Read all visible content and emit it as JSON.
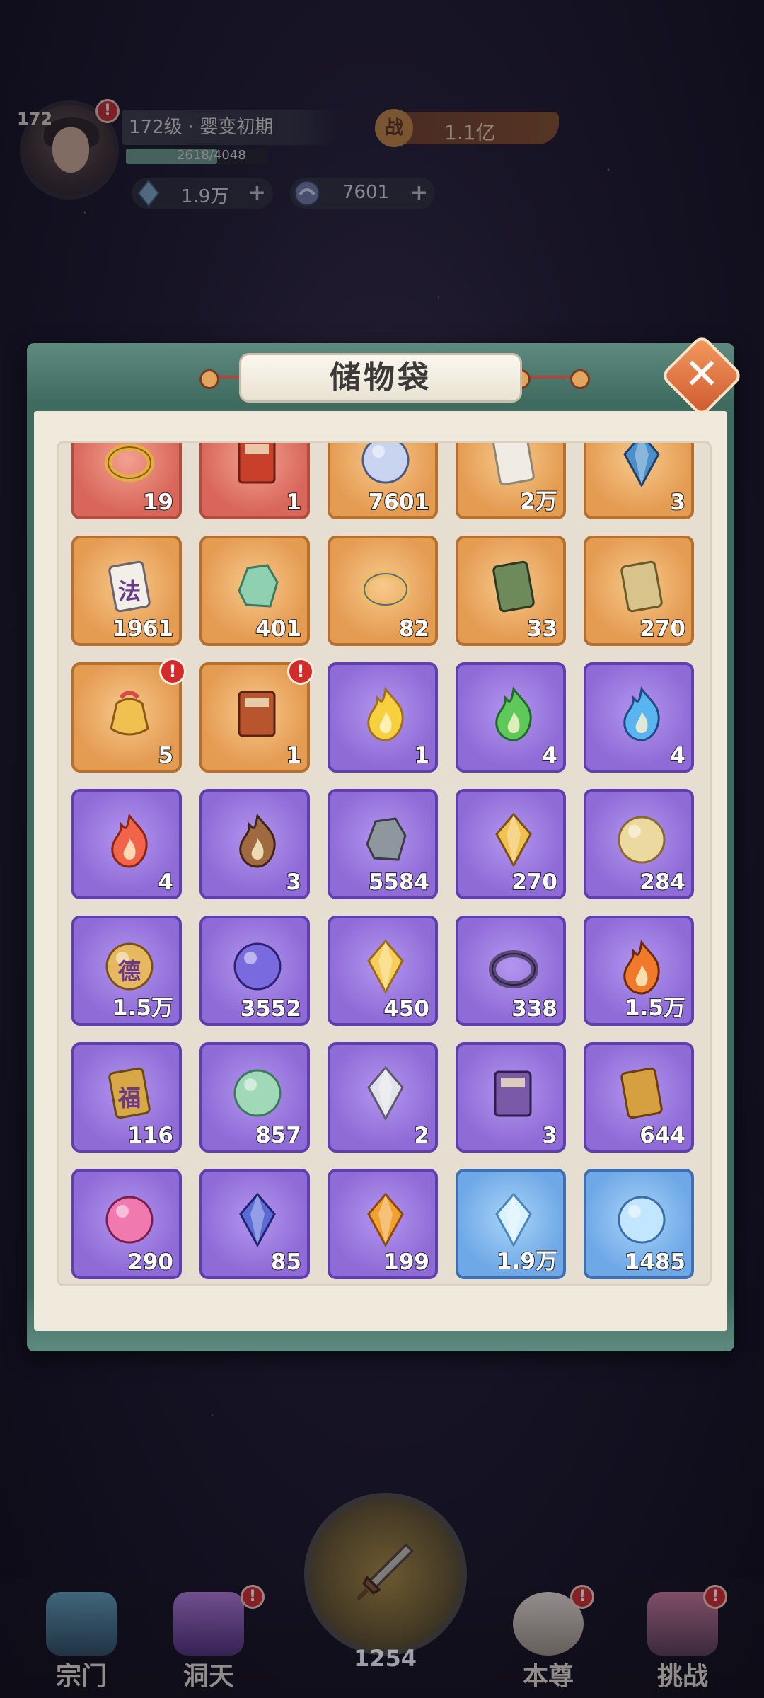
{
  "hud": {
    "level_badge": "172",
    "realm_label": "172级 · 婴变初期",
    "exp_text": "2618/4048",
    "exp_progress": 0.647,
    "power_glyph": "战",
    "power_value": "1.1亿",
    "gem_value": "1.9万",
    "coin_value": "7601",
    "plus_glyph": "+",
    "alert_glyph": "!"
  },
  "modal": {
    "title": "储物袋",
    "close_glyph": "✕"
  },
  "inventory": [
    [
      {
        "qty": "19",
        "rarity": "red",
        "icon": "golden-ring-icon"
      },
      {
        "qty": "1",
        "rarity": "red",
        "icon": "red-book-icon"
      },
      {
        "qty": "7601",
        "rarity": "orange",
        "icon": "spirit-coin-icon"
      },
      {
        "qty": "2万",
        "rarity": "orange",
        "icon": "white-cloth-icon"
      },
      {
        "qty": "3",
        "rarity": "orange",
        "icon": "blue-crystal-shard-icon"
      }
    ],
    [
      {
        "qty": "1961",
        "rarity": "orange",
        "icon": "law-talisman-icon",
        "glyph": "法"
      },
      {
        "qty": "401",
        "rarity": "orange",
        "icon": "jade-lion-icon"
      },
      {
        "qty": "82",
        "rarity": "orange",
        "icon": "golden-bracelet-icon"
      },
      {
        "qty": "33",
        "rarity": "orange",
        "icon": "scroll-cards-icon"
      },
      {
        "qty": "270",
        "rarity": "orange",
        "icon": "map-scroll-icon"
      }
    ],
    [
      {
        "qty": "5",
        "rarity": "orange",
        "icon": "treasure-bag-icon",
        "alert": true
      },
      {
        "qty": "1",
        "rarity": "orange",
        "icon": "selection-book-icon",
        "alert": true
      },
      {
        "qty": "1",
        "rarity": "purple",
        "icon": "yellow-flame-icon"
      },
      {
        "qty": "4",
        "rarity": "purple",
        "icon": "green-flame-icon"
      },
      {
        "qty": "4",
        "rarity": "purple",
        "icon": "blue-flame-icon"
      }
    ],
    [
      {
        "qty": "4",
        "rarity": "purple",
        "icon": "red-flame-icon"
      },
      {
        "qty": "3",
        "rarity": "purple",
        "icon": "brown-flame-icon"
      },
      {
        "qty": "5584",
        "rarity": "purple",
        "icon": "iron-ore-icon"
      },
      {
        "qty": "270",
        "rarity": "purple",
        "icon": "gold-crystal-icon"
      },
      {
        "qty": "284",
        "rarity": "purple",
        "icon": "compass-icon"
      }
    ],
    [
      {
        "qty": "1.5万",
        "rarity": "purple",
        "icon": "virtue-token-icon",
        "glyph": "德"
      },
      {
        "qty": "3552",
        "rarity": "purple",
        "icon": "spirit-orb-icon"
      },
      {
        "qty": "450",
        "rarity": "purple",
        "icon": "amber-crystal-icon"
      },
      {
        "qty": "338",
        "rarity": "purple",
        "icon": "dark-bracelet-icon"
      },
      {
        "qty": "1.5万",
        "rarity": "purple",
        "icon": "fire-seal-icon"
      }
    ],
    [
      {
        "qty": "116",
        "rarity": "purple",
        "icon": "fortune-ticket-icon",
        "glyph": "福"
      },
      {
        "qty": "857",
        "rarity": "purple",
        "icon": "jade-gourd-icon"
      },
      {
        "qty": "2",
        "rarity": "purple",
        "icon": "silver-rune-diamond-icon"
      },
      {
        "qty": "3",
        "rarity": "purple",
        "icon": "purple-tome-icon"
      },
      {
        "qty": "644",
        "rarity": "purple",
        "icon": "gold-card-icon"
      }
    ],
    [
      {
        "qty": "290",
        "rarity": "purple",
        "icon": "pink-pearl-icon"
      },
      {
        "qty": "85",
        "rarity": "purple",
        "icon": "blue-feather-icon"
      },
      {
        "qty": "199",
        "rarity": "purple",
        "icon": "fire-crystal-icon"
      },
      {
        "qty": "1.9万",
        "rarity": "blue",
        "icon": "ice-crystal-icon"
      },
      {
        "qty": "1485",
        "rarity": "blue",
        "icon": "water-orb-icon"
      }
    ]
  ],
  "nav": {
    "items": [
      {
        "label": "宗门",
        "icon": "sect-pagoda-icon"
      },
      {
        "label": "洞天",
        "icon": "cave-tree-icon"
      },
      {
        "label": "本尊",
        "icon": "character-portrait-icon"
      },
      {
        "label": "挑战",
        "icon": "challenge-banner-icon"
      }
    ],
    "center_count": "1254",
    "center_icon": "sword-icon"
  },
  "colors": {
    "frame": "#3f6a60",
    "paper": "#f0eadc",
    "orange_cell": "#e49b52",
    "red_cell": "#d8665a",
    "purple_cell": "#8e6bd6",
    "blue_cell": "#6ea8e6",
    "alert": "#d42a2a"
  }
}
